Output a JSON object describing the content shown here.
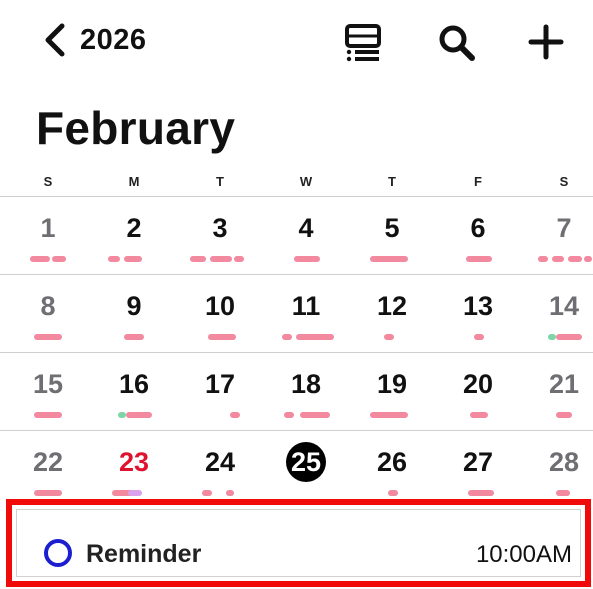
{
  "header": {
    "back_label": "2026",
    "icons": [
      "chevron-left-icon",
      "list-view-icon",
      "search-icon",
      "plus-icon"
    ]
  },
  "month_title": "February",
  "weekdays": [
    "S",
    "M",
    "T",
    "W",
    "T",
    "F",
    "S"
  ],
  "weeks": [
    [
      "1",
      "2",
      "3",
      "4",
      "5",
      "6",
      "7"
    ],
    [
      "8",
      "9",
      "10",
      "11",
      "12",
      "13",
      "14"
    ],
    [
      "15",
      "16",
      "17",
      "18",
      "19",
      "20",
      "21"
    ],
    [
      "22",
      "23",
      "24",
      "25",
      "26",
      "27",
      "28"
    ]
  ],
  "highlighted_day": "23",
  "today": "25",
  "reminder": {
    "title": "Reminder",
    "time": "10:00AM"
  },
  "colors": {
    "accent_red": "#e0132f",
    "event_pink": "#f2899f",
    "event_green": "#7ed6a8",
    "event_purple": "#d9a2ea",
    "reminder_ring": "#1c1fd0",
    "highlight_frame": "#f00a0a"
  }
}
